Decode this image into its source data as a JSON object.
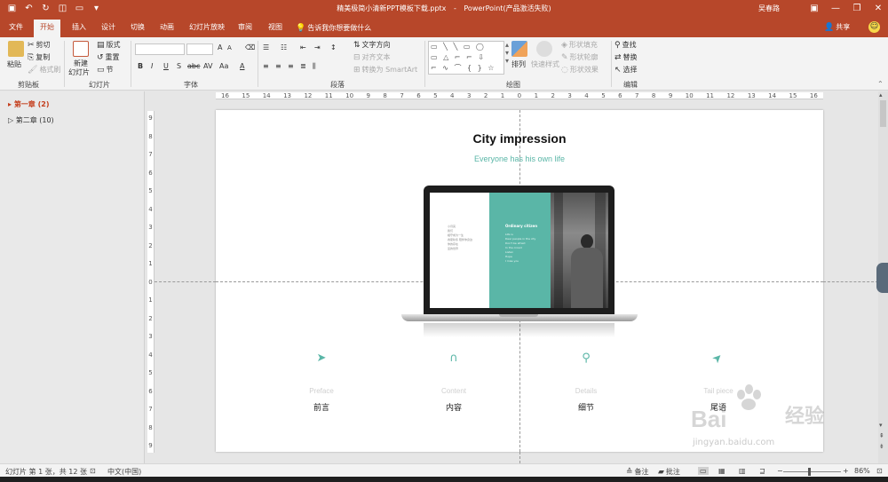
{
  "colors": {
    "accent": "#b7472a",
    "teal": "#5ab6a7",
    "active_section": "#c43e1c"
  },
  "titlebar": {
    "doc_title": "精美极简小清新PPT模板下载.pptx",
    "separator": "-",
    "app_name": "PowerPoint(产品激活失败)",
    "user": "吴春路",
    "qat_icons": [
      "save-icon",
      "undo-icon",
      "redo-icon",
      "present-icon",
      "new-doc-icon",
      "customize-icon"
    ],
    "min_glyph": "—",
    "restore_glyph": "❐",
    "close_glyph": "✕"
  },
  "tabs": [
    "文件",
    "开始",
    "插入",
    "设计",
    "切换",
    "动画",
    "幻灯片放映",
    "审阅",
    "视图"
  ],
  "tell_me": "告诉我你想要做什么",
  "share": "共享",
  "ribbon": {
    "clipboard": {
      "paste": "粘贴",
      "cut": "剪切",
      "copy": "复制",
      "format_painter": "格式刷",
      "label": "剪贴板"
    },
    "slides": {
      "new_slide": "新建",
      "new_slide_2": "幻灯片",
      "layout": "版式",
      "reset": "重置",
      "section": "节",
      "label": "幻灯片"
    },
    "font": {
      "label": "字体",
      "bold": "B",
      "italic": "I",
      "underline": "U",
      "strike": "S",
      "shadow": "abc",
      "spacing": "AV",
      "case": "Aa",
      "color": "A",
      "grow": "A",
      "shrink": "A"
    },
    "paragraph": {
      "text_direction": "文字方向",
      "align_text": "对齐文本",
      "smartart": "转换为 SmartArt",
      "label": "段落"
    },
    "drawing": {
      "arrange": "排列",
      "quick_styles": "快速样式",
      "shape_fill": "形状填充",
      "shape_outline": "形状轮廓",
      "shape_effects": "形状效果",
      "label": "绘图"
    },
    "editing": {
      "find": "查找",
      "replace": "替换",
      "select": "选择",
      "label": "编辑"
    }
  },
  "sections": [
    {
      "label": "第一章 (2)",
      "active": true
    },
    {
      "label": "第二章 (10)",
      "active": false
    }
  ],
  "ruler_h": [
    "16",
    "15",
    "14",
    "13",
    "12",
    "11",
    "10",
    "9",
    "8",
    "7",
    "6",
    "5",
    "4",
    "3",
    "2",
    "1",
    "0",
    "1",
    "2",
    "3",
    "4",
    "5",
    "6",
    "7",
    "8",
    "9",
    "10",
    "11",
    "12",
    "13",
    "14",
    "15",
    "16"
  ],
  "ruler_v": [
    "9",
    "8",
    "7",
    "6",
    "5",
    "4",
    "3",
    "2",
    "1",
    "0",
    "1",
    "2",
    "3",
    "4",
    "5",
    "6",
    "7",
    "8",
    "9"
  ],
  "slide": {
    "title": "City impression",
    "subtitle": "Everyone has his own life",
    "screen": {
      "left_lines": [
        "小月亮",
        "",
        "我们",
        "相守成为一生",
        "春夏秋冬 陪伴你身边",
        "你的存在",
        "爱的世界"
      ],
      "mid_title": "Ordinary citizen",
      "mid_lines": [
        "Life is",
        "Dear people in the city",
        "Don't be afraid",
        "In the crowd",
        "Listen",
        "Hope",
        "I miss you"
      ]
    },
    "items": [
      {
        "icon": "➤",
        "en": "Preface",
        "cn": "前言",
        "icon_name": "send-icon"
      },
      {
        "icon": "∩",
        "en": "Content",
        "cn": "内容",
        "icon_name": "arch-icon"
      },
      {
        "icon": "⚲",
        "en": "Details",
        "cn": "细节",
        "icon_name": "search-icon"
      },
      {
        "icon": "➤",
        "en": "Tail piece",
        "cn": "尾语",
        "icon_name": "navigation-icon"
      }
    ]
  },
  "watermark": {
    "text": "Bai",
    "text2": "经验",
    "url": "jingyan.baidu.com"
  },
  "statusbar": {
    "slide_info": "幻灯片 第 1 张，共 12 张",
    "language": "中文(中国)",
    "notes": "备注",
    "comments": "批注",
    "zoom": "86%",
    "zoom_minus": "−",
    "zoom_plus": "+"
  }
}
